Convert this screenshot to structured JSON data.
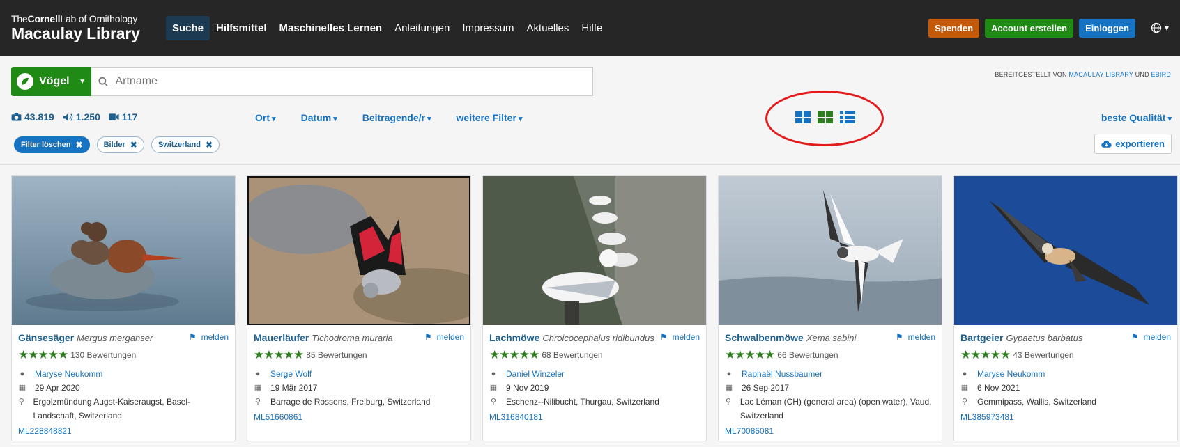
{
  "header": {
    "logo_lab_pre": "The",
    "logo_lab_bold": "Cornell",
    "logo_lab_post": "Lab of Ornithology",
    "logo_library": "Macaulay Library",
    "nav": [
      "Suche",
      "Hilfsmittel",
      "Maschinelles Lernen",
      "Anleitungen",
      "Impressum",
      "Aktuelles",
      "Hilfe"
    ],
    "buttons": {
      "donate": "Spenden",
      "create_account": "Account erstellen",
      "login": "Einloggen"
    }
  },
  "search": {
    "taxon": "Vögel",
    "placeholder": "Artname",
    "provided_by_prefix": "BEREITGESTELLT VON",
    "provider_1": "MACAULAY LIBRARY",
    "provided_and": "UND",
    "provider_2": "EBIRD"
  },
  "counts": {
    "photos": "43.819",
    "audio": "1.250",
    "video": "117"
  },
  "filters": [
    "Ort",
    "Datum",
    "Beitragende/r",
    "weitere Filter"
  ],
  "sort_label": "beste Qualität",
  "chips": {
    "clear": "Filter löschen",
    "media": "Bilder",
    "region": "Switzerland"
  },
  "export_label": "exportieren",
  "cards": [
    {
      "common": "Gänsesäger",
      "sci": "Mergus merganser",
      "report": "melden",
      "stars": "★★★★★",
      "ratings": "130 Bewertungen",
      "author": "Maryse Neukomm",
      "date": "29 Apr 2020",
      "location": "Ergolzmündung Augst-Kaiseraugst, Basel-Landschaft, Switzerland",
      "ml": "ML228848821"
    },
    {
      "common": "Mauerläufer",
      "sci": "Tichodroma muraria",
      "report": "melden",
      "stars": "★★★★★",
      "ratings": "85 Bewertungen",
      "author": "Serge Wolf",
      "date": "19 Mär 2017",
      "location": "Barrage de Rossens, Freiburg, Switzerland",
      "ml": "ML51660861"
    },
    {
      "common": "Lachmöwe",
      "sci": "Chroicocephalus ridibundus",
      "report": "melden",
      "stars": "★★★★★",
      "ratings": "68 Bewertungen",
      "author": "Daniel Winzeler",
      "date": "9 Nov 2019",
      "location": "Eschenz--Nilibucht, Thurgau, Switzerland",
      "ml": "ML316840181"
    },
    {
      "common": "Schwalbenmöwe",
      "sci": "Xema sabini",
      "report": "melden",
      "stars": "★★★★★",
      "ratings": "66 Bewertungen",
      "author": "Raphaël Nussbaumer",
      "date": "26 Sep 2017",
      "location": "Lac Léman (CH) (general area) (open water), Vaud, Switzerland",
      "ml": "ML70085081"
    },
    {
      "common": "Bartgeier",
      "sci": "Gypaetus barbatus",
      "report": "melden",
      "stars": "★★★★★",
      "ratings": "43 Bewertungen",
      "author": "Maryse Neukomm",
      "date": "6 Nov 2021",
      "location": "Gemmipass, Wallis, Switzerland",
      "ml": "ML385973481"
    }
  ],
  "colors": {
    "header_bg": "#262626",
    "accent_blue": "#1673c2",
    "green": "#1f8a14",
    "donate": "#c25a0a",
    "highlight_ring": "#e31b1b"
  }
}
